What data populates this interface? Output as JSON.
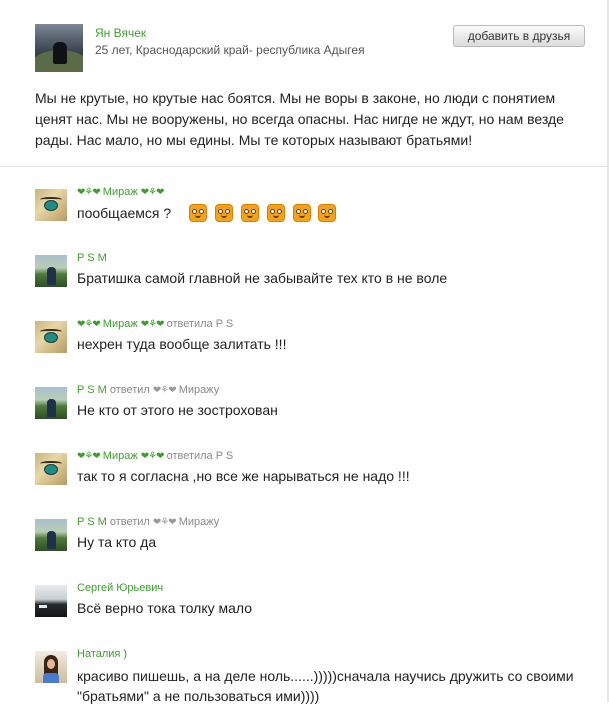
{
  "post": {
    "author_name": "Ян Вячек",
    "author_info": "25 лет, Краснодарский край- республика Адыгея",
    "add_friend_label": "добавить в друзья",
    "status_text": "Мы не крутые, но крутые нас боятся. Мы не воры в законе, но люди с понятием ценят нас. Мы не вооружены, но всегда опасны. Нас нигде не ждут, но нам везде рады. Нас мало, но мы едины. Мы те которых называют братьями!"
  },
  "decor": {
    "hearts": "❤⚘❤"
  },
  "comments": [
    {
      "author": "Мираж",
      "reply": "",
      "reply_to": "",
      "text": "пообщаемся ?",
      "emoji_count": 6
    },
    {
      "author": "P S M",
      "reply": "",
      "reply_to": "",
      "text": "Братишка самой главной не забывайте тех кто в не воле"
    },
    {
      "author": "Мираж",
      "reply": "ответила",
      "reply_to": "P S",
      "text": "нехрен туда вообще залитать !!!"
    },
    {
      "author": "P S M",
      "reply": "ответил",
      "reply_to": "Миражу",
      "text": "Не кто от этого не зострохован"
    },
    {
      "author": "Мираж",
      "reply": "ответила",
      "reply_to": "P S",
      "text": "так то я согласна ,но все же нарываться не надо !!!"
    },
    {
      "author": "P S M",
      "reply": "ответил",
      "reply_to": "Миражу",
      "text": "Ну та кто да"
    },
    {
      "author": "Сергей Юрьевич",
      "reply": "",
      "reply_to": "",
      "text": "Всё верно тока толку мало"
    },
    {
      "author": "Наталия )",
      "reply": "",
      "reply_to": "",
      "text": "красиво пишешь, а на деле ноль......)))))сначала научись дружить со своими \"братьями\" а не пользоваться ими))))"
    }
  ],
  "colors": {
    "name_green": "#3e9e2e",
    "reply_grey": "#8a8a8a",
    "divider": "#e3e3e3"
  }
}
